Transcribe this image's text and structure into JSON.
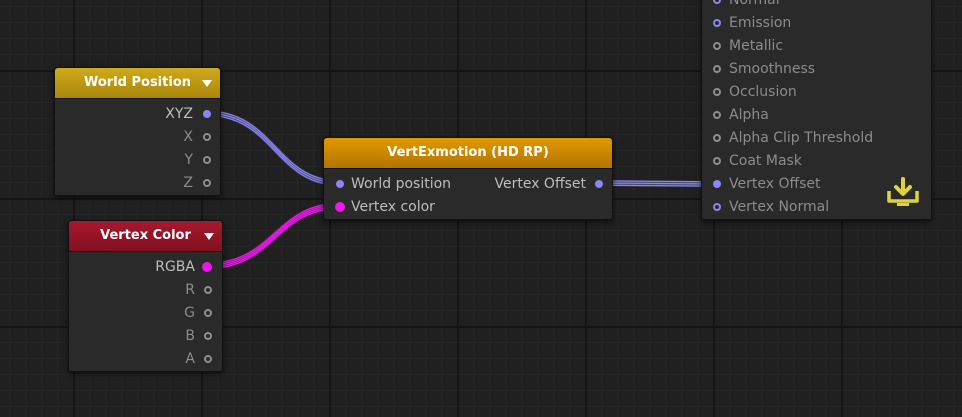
{
  "nodes": {
    "world_position": {
      "title": "World Position",
      "outputs": [
        "XYZ",
        "X",
        "Y",
        "Z"
      ]
    },
    "vertex_color": {
      "title": "Vertex Color",
      "outputs": [
        "RGBA",
        "R",
        "G",
        "B",
        "A"
      ]
    },
    "vertexmotion": {
      "title": "VertExmotion (HD RP)",
      "inputs": [
        "World position",
        "Vertex color"
      ],
      "outputs": [
        "Vertex Offset"
      ]
    },
    "master": {
      "inputs": [
        "Normal",
        "Emission",
        "Metallic",
        "Smoothness",
        "Occlusion",
        "Alpha",
        "Alpha Clip Threshold",
        "Coat Mask",
        "Vertex Offset",
        "Vertex Normal"
      ]
    }
  },
  "colors": {
    "world_position_header": "#c8a214",
    "vertex_color_header": "#9a1428",
    "vertexmotion_header": "#d99200",
    "vector_port": "#8a86f2",
    "color_port": "#ee18ee",
    "master_icon": "#e1d13c"
  },
  "icons": {
    "master_output": "download-icon"
  }
}
